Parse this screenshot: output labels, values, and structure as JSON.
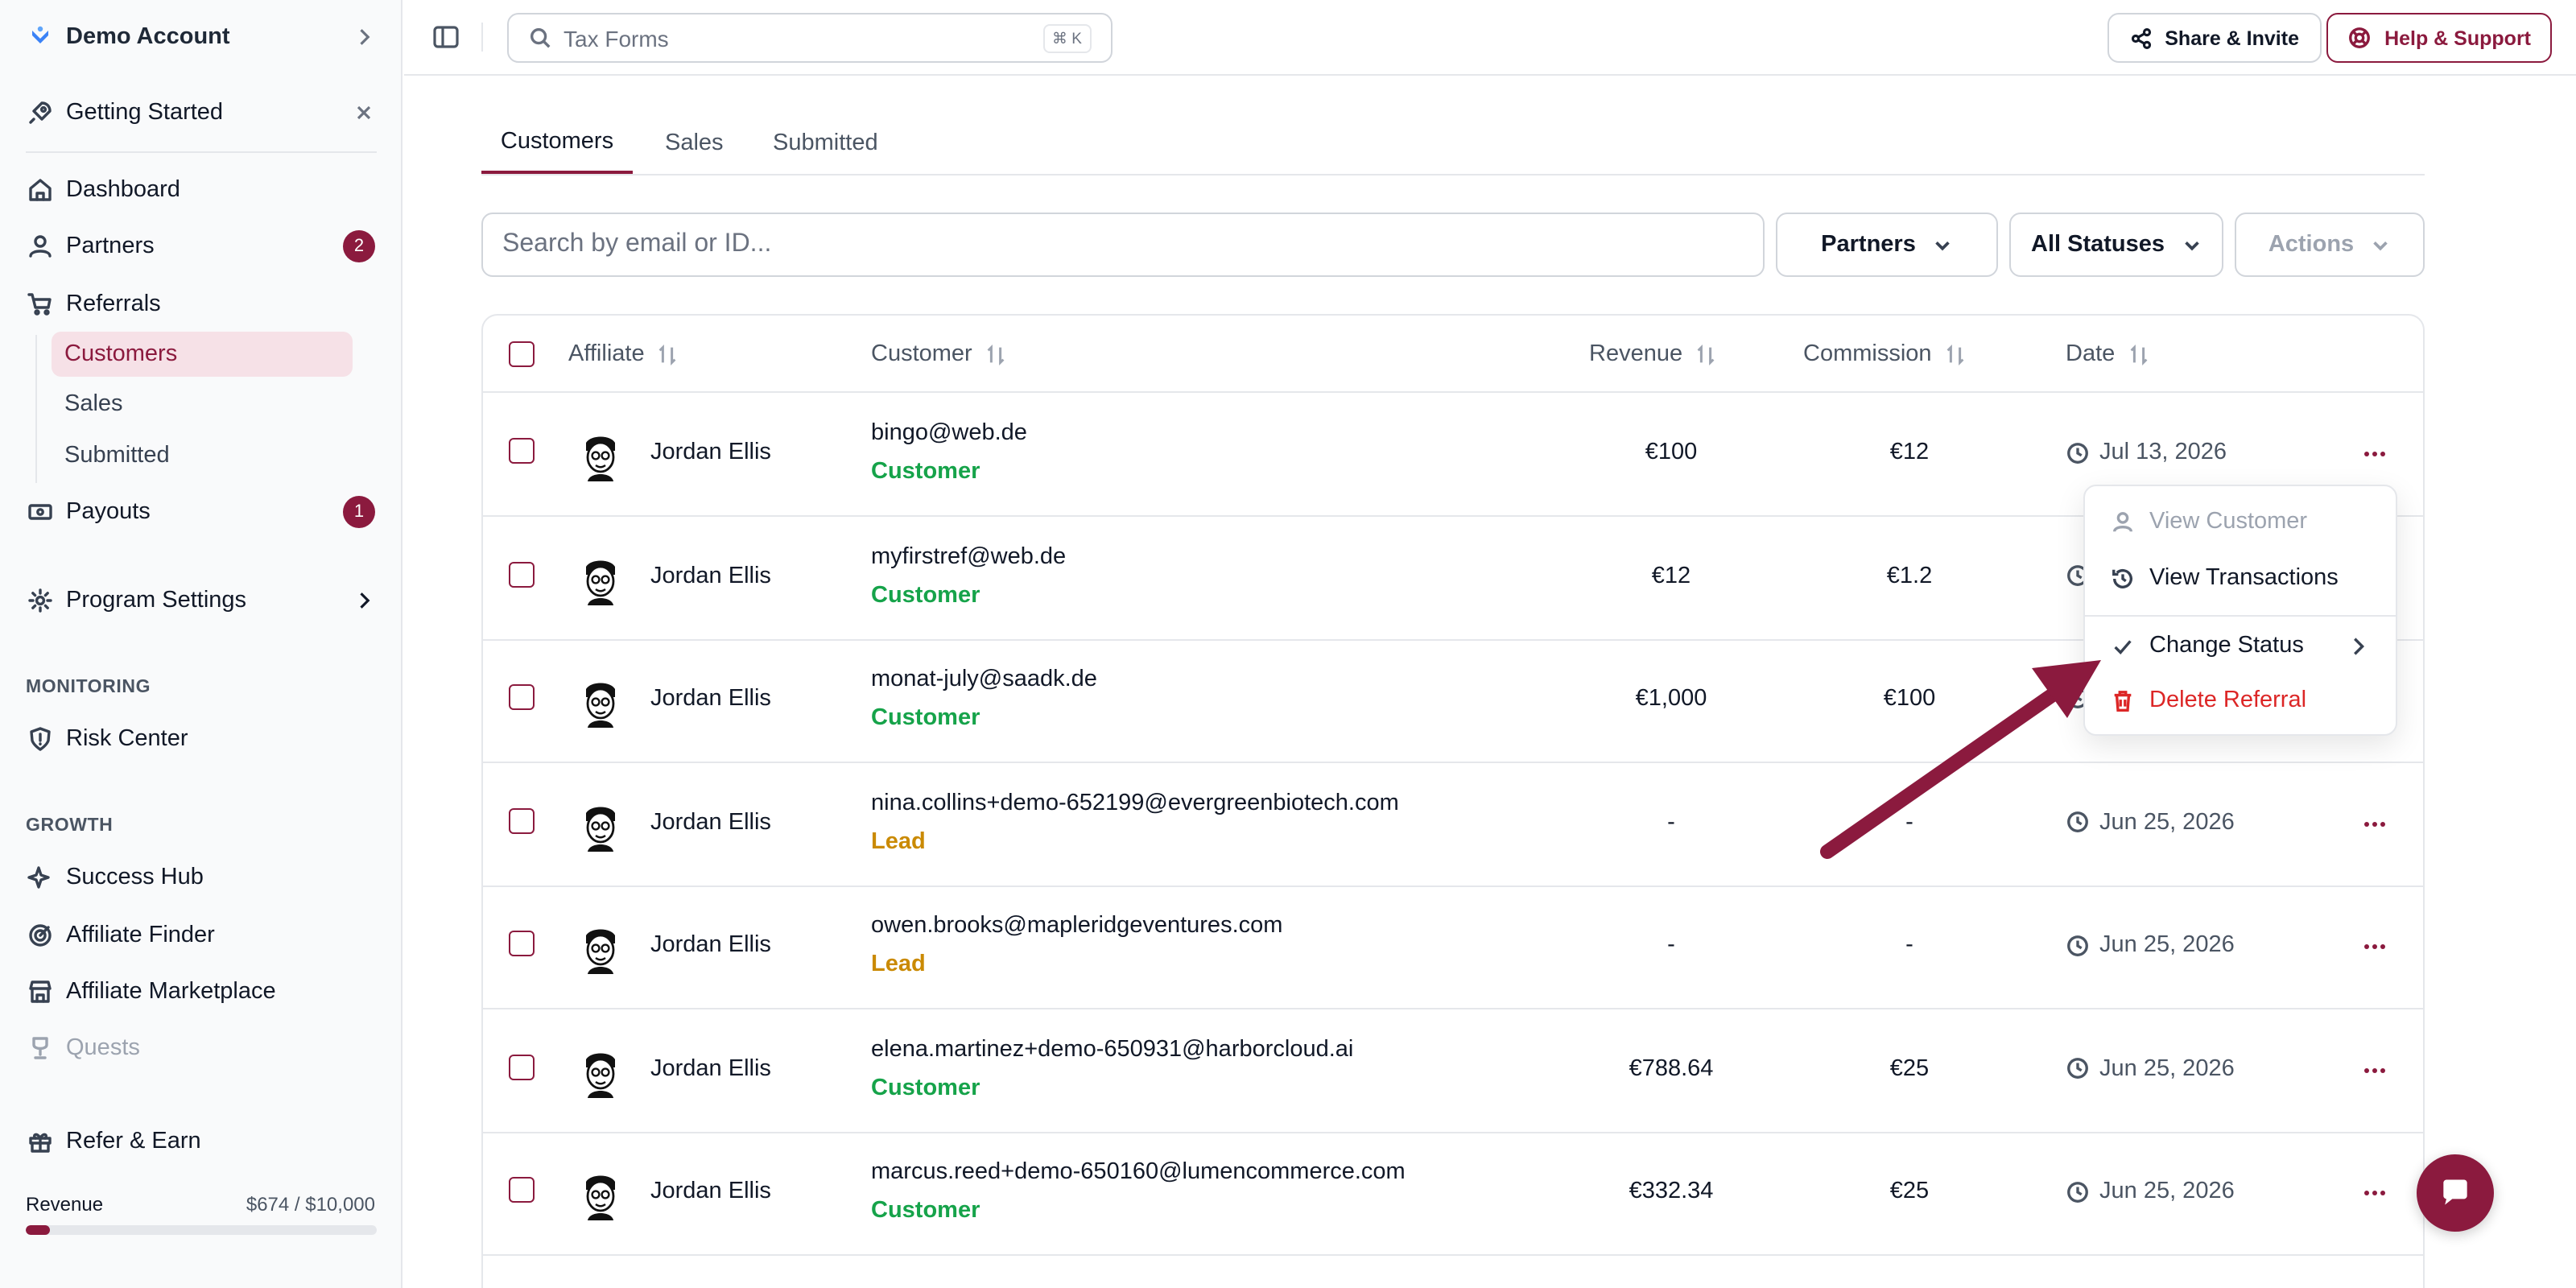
{
  "sidebar": {
    "account": "Demo Account",
    "getting_started": "Getting Started",
    "nav": {
      "dashboard": "Dashboard",
      "partners": "Partners",
      "partners_badge": "2",
      "referrals": "Referrals",
      "referrals_sub": [
        "Customers",
        "Sales",
        "Submitted"
      ],
      "payouts": "Payouts",
      "payouts_badge": "1",
      "program_settings": "Program Settings"
    },
    "monitoring_title": "MONITORING",
    "risk_center": "Risk Center",
    "growth_title": "GROWTH",
    "success_hub": "Success Hub",
    "affiliate_finder": "Affiliate Finder",
    "affiliate_marketplace": "Affiliate Marketplace",
    "quests": "Quests",
    "refer_earn": "Refer & Earn",
    "revenue_label": "Revenue",
    "revenue_value": "$674 / $10,000",
    "revenue_progress": 0.0674
  },
  "topbar": {
    "search_placeholder": "Tax Forms",
    "shortcut": "⌘ K",
    "share_label": "Share & Invite",
    "help_label": "Help & Support"
  },
  "tabs": [
    "Customers",
    "Sales",
    "Submitted"
  ],
  "active_tab": "Customers",
  "filters": {
    "search_placeholder": "Search by email or ID...",
    "partners": "Partners",
    "statuses": "All Statuses",
    "actions": "Actions"
  },
  "table": {
    "headers": {
      "affiliate": "Affiliate",
      "customer": "Customer",
      "revenue": "Revenue",
      "commission": "Commission",
      "date": "Date"
    },
    "rows": [
      {
        "affiliate": "Jordan Ellis",
        "email": "bingo@web.de",
        "status": "Customer",
        "revenue": "€100",
        "commission": "€12",
        "date": "Jul 13, 2026"
      },
      {
        "affiliate": "Jordan Ellis",
        "email": "myfirstref@web.de",
        "status": "Customer",
        "revenue": "€12",
        "commission": "€1.2",
        "date": ""
      },
      {
        "affiliate": "Jordan Ellis",
        "email": "monat-july@saadk.de",
        "status": "Customer",
        "revenue": "€1,000",
        "commission": "€100",
        "date": ""
      },
      {
        "affiliate": "Jordan Ellis",
        "email": "nina.collins+demo-652199@evergreenbiotech.com",
        "status": "Lead",
        "revenue": "-",
        "commission": "-",
        "date": "Jun 25, 2026"
      },
      {
        "affiliate": "Jordan Ellis",
        "email": "owen.brooks@mapleridgeventures.com",
        "status": "Lead",
        "revenue": "-",
        "commission": "-",
        "date": "Jun 25, 2026"
      },
      {
        "affiliate": "Jordan Ellis",
        "email": "elena.martinez+demo-650931@harborcloud.ai",
        "status": "Customer",
        "revenue": "€788.64",
        "commission": "€25",
        "date": "Jun 25, 2026"
      },
      {
        "affiliate": "Jordan Ellis",
        "email": "marcus.reed+demo-650160@lumencommerce.com",
        "status": "Customer",
        "revenue": "€332.34",
        "commission": "€25",
        "date": "Jun 25, 2026"
      }
    ]
  },
  "menu": {
    "view_customer": "View Customer",
    "view_transactions": "View Transactions",
    "change_status": "Change Status",
    "delete_referral": "Delete Referral"
  },
  "colors": {
    "accent": "#8b1a3e",
    "customer_status": "#16a34a",
    "lead_status": "#ca8a04",
    "danger": "#dc2626"
  }
}
